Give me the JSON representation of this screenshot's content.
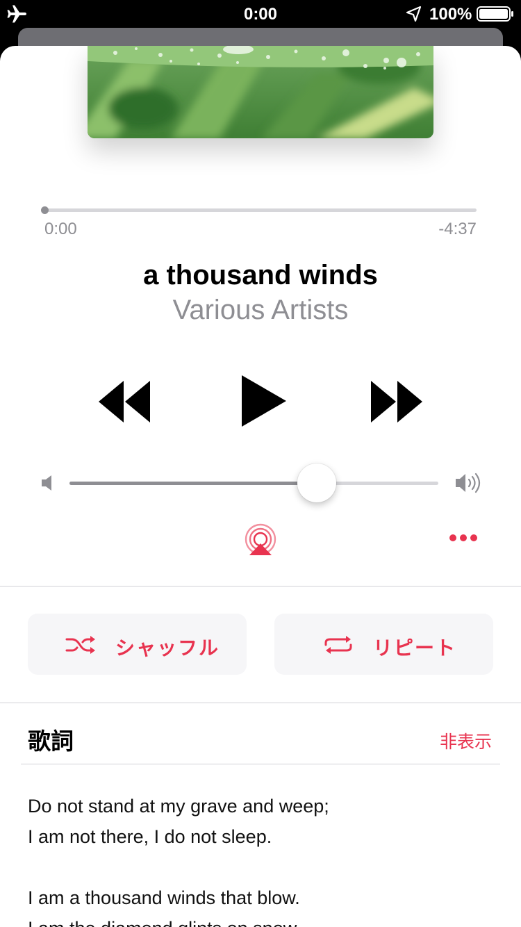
{
  "status_bar": {
    "time": "0:00",
    "battery_percent": "100%",
    "icons": [
      "airplane-icon",
      "location-arrow-icon",
      "battery-icon"
    ]
  },
  "player": {
    "progress_fraction": 0.0,
    "elapsed": "0:00",
    "remaining": "-4:37",
    "title": "a thousand winds",
    "artist": "Various Artists",
    "volume_fraction": 0.67,
    "controls": [
      "rewind-icon",
      "play-icon",
      "fast-forward-icon"
    ]
  },
  "actions": {
    "shuffle_label": "シャッフル",
    "repeat_label": "リピート"
  },
  "lyrics": {
    "header": "歌詞",
    "hide_label": "非表示",
    "lines": [
      "Do not stand at my grave and weep;",
      "I am not there, I do not sleep.",
      "",
      "I am a thousand winds that blow.",
      "I am the diamond glints on snow."
    ]
  },
  "colors": {
    "accent": "#e8334f",
    "secondary_text": "#8e8e93",
    "button_bg": "#f6f6f8"
  }
}
